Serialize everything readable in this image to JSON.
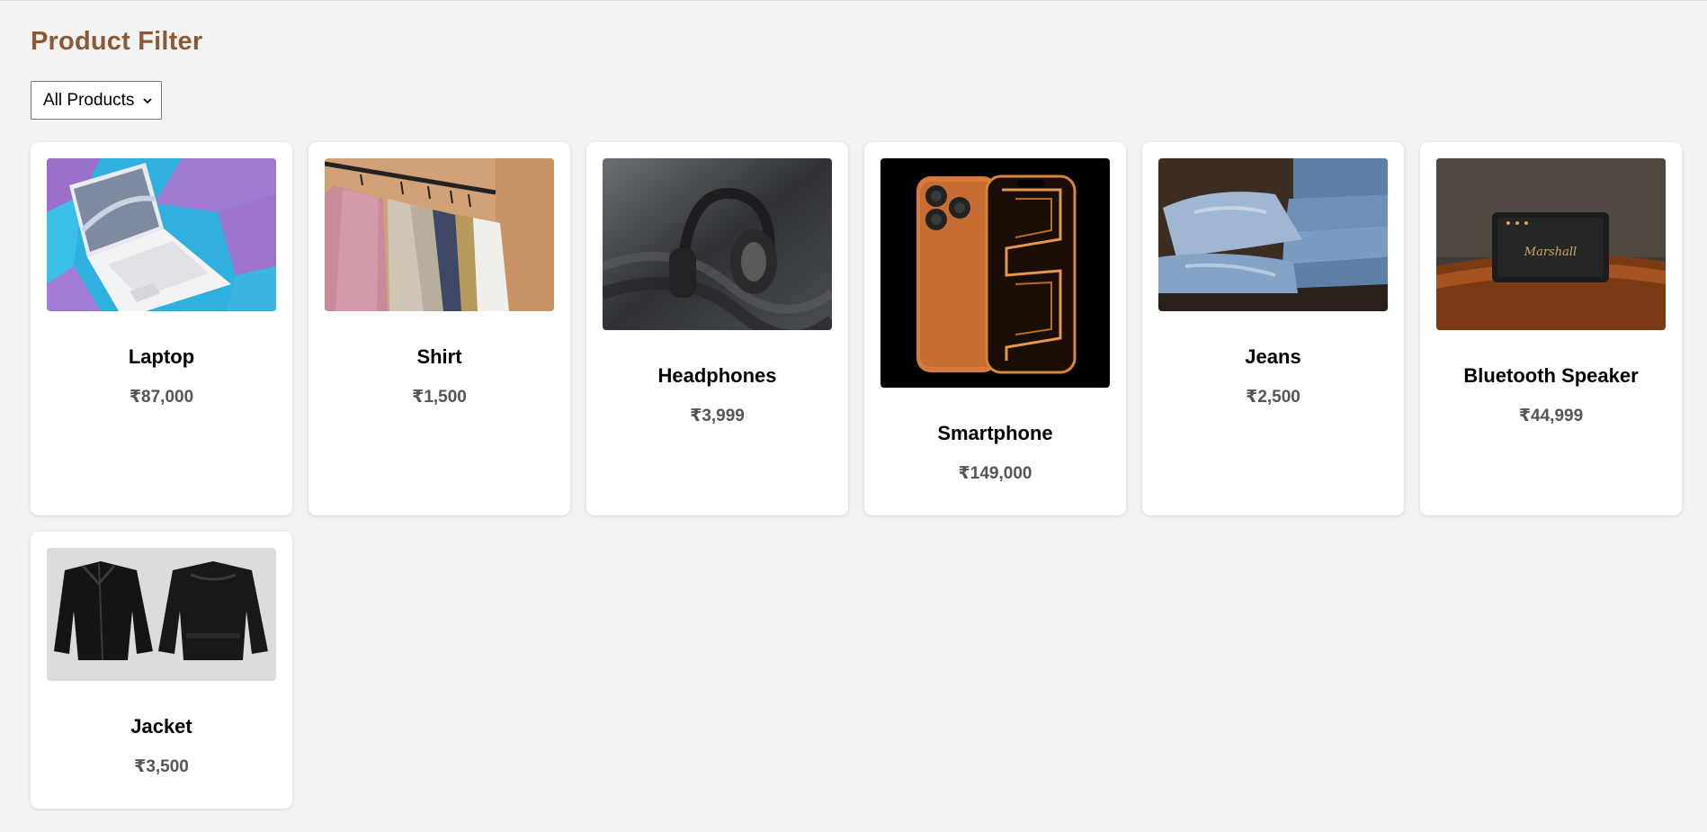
{
  "header": {
    "title": "Product Filter"
  },
  "filter": {
    "selected": "All Products"
  },
  "products": [
    {
      "name": "Laptop",
      "price": "₹87,000",
      "image_icon": "laptop-image"
    },
    {
      "name": "Shirt",
      "price": "₹1,500",
      "image_icon": "shirts-on-rack-image"
    },
    {
      "name": "Headphones",
      "price": "₹3,999",
      "image_icon": "headphones-image"
    },
    {
      "name": "Smartphone",
      "price": "₹149,000",
      "image_icon": "smartphone-image"
    },
    {
      "name": "Jeans",
      "price": "₹2,500",
      "image_icon": "jeans-stack-image"
    },
    {
      "name": "Bluetooth Speaker",
      "price": "₹44,999",
      "image_icon": "speaker-image"
    },
    {
      "name": "Jacket",
      "price": "₹3,500",
      "image_icon": "leather-jacket-image"
    }
  ],
  "colors": {
    "title": "#8b5a35",
    "background": "#f3f3f3",
    "card": "#ffffff",
    "price": "#555555"
  }
}
